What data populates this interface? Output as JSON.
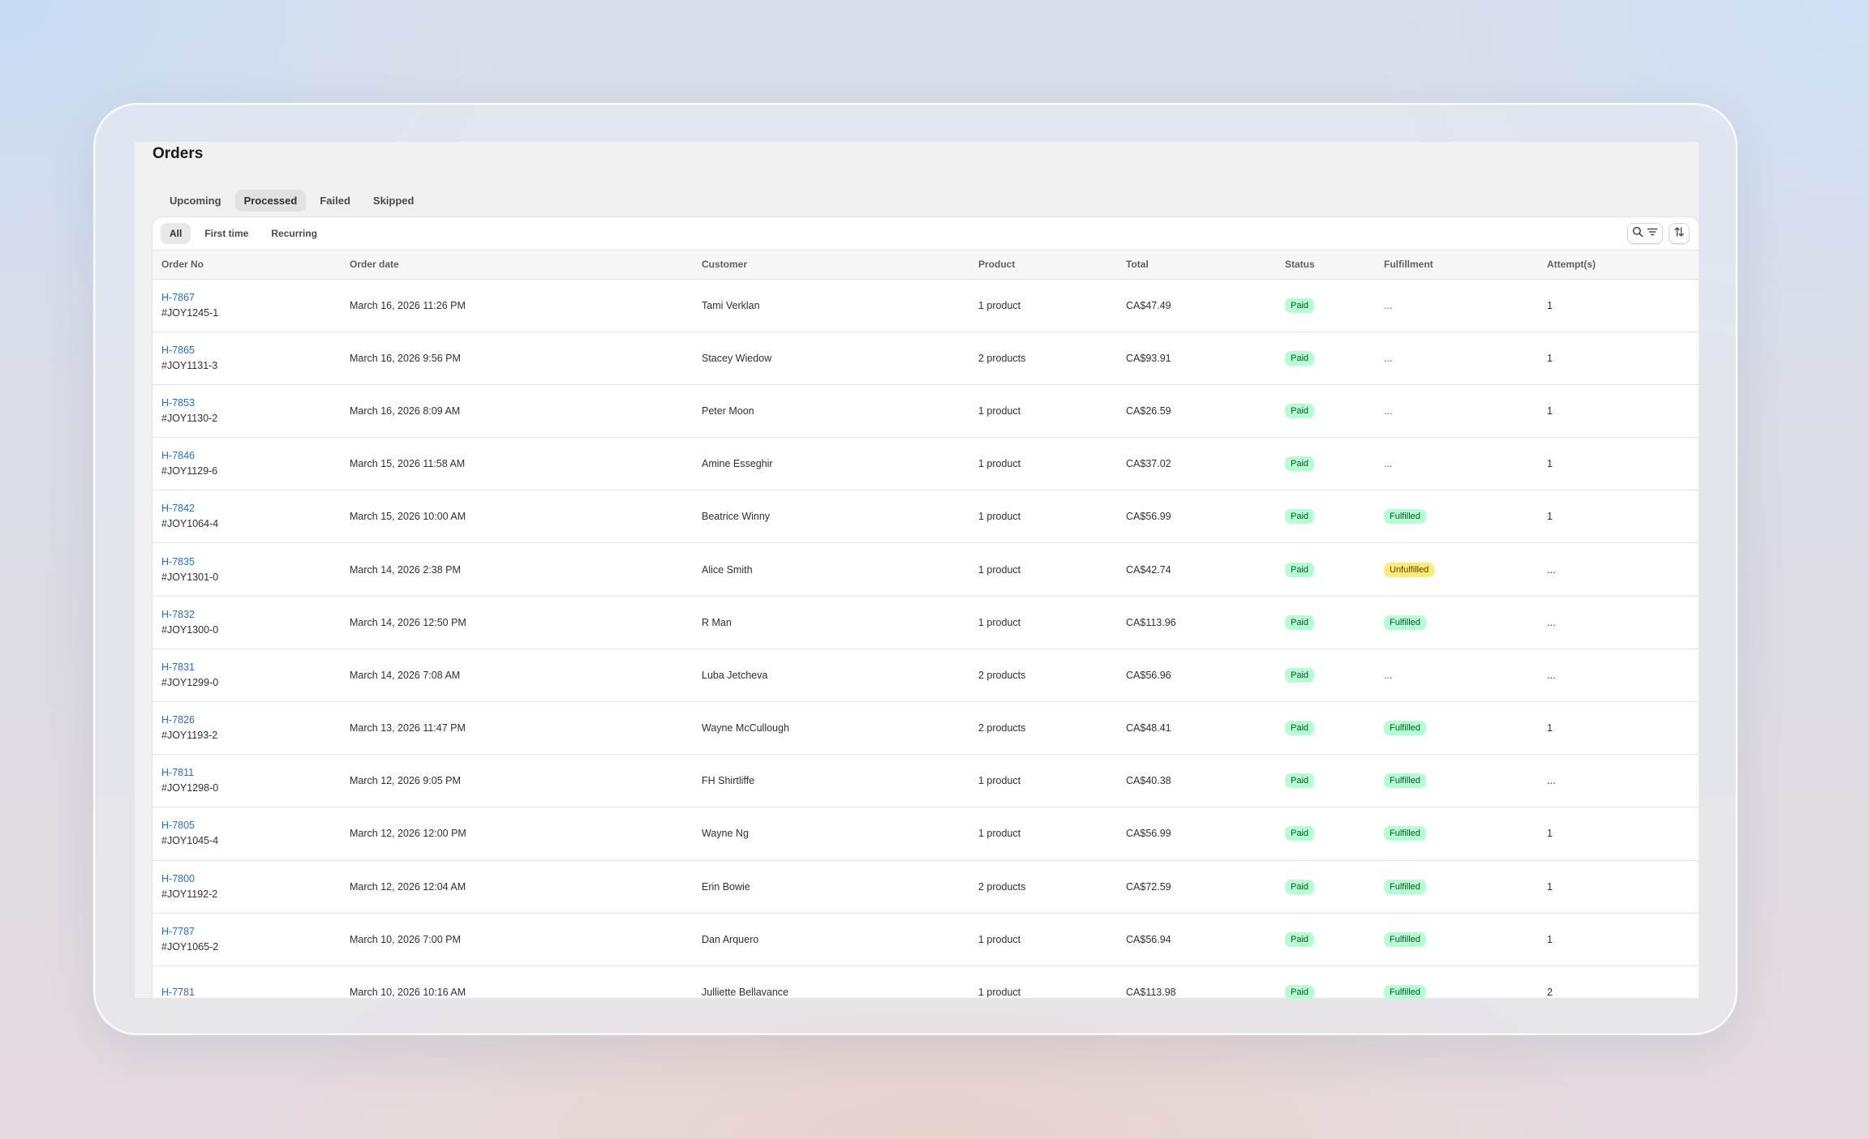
{
  "page": {
    "title": "Orders"
  },
  "tabs": [
    {
      "label": "Upcoming",
      "active": false
    },
    {
      "label": "Processed",
      "active": true
    },
    {
      "label": "Failed",
      "active": false
    },
    {
      "label": "Skipped",
      "active": false
    }
  ],
  "filters": [
    {
      "label": "All",
      "active": true
    },
    {
      "label": "First time",
      "active": false
    },
    {
      "label": "Recurring",
      "active": false
    }
  ],
  "icons": {
    "search": "search-icon",
    "filter": "filter-lines-icon",
    "sort": "sort-arrows-icon"
  },
  "colors": {
    "link": "#2c6ecb",
    "success_badge": "#b4fed2",
    "warning_badge": "#ffeb78"
  },
  "table": {
    "columns": [
      "Order No",
      "Order date",
      "Customer",
      "Product",
      "Total",
      "Status",
      "Fulfillment",
      "Attempt(s)"
    ],
    "rows": [
      {
        "order_no": "H-7867",
        "order_ref": "#JOY1245-1",
        "date": "March 16, 2026 11:26 PM",
        "customer": "Tami Verklan",
        "product": "1 product",
        "total": "CA$47.49",
        "status": "Paid",
        "fulfillment": "...",
        "attempts": "1"
      },
      {
        "order_no": "H-7865",
        "order_ref": "#JOY1131-3",
        "date": "March 16, 2026 9:56 PM",
        "customer": "Stacey Wiedow",
        "product": "2 products",
        "total": "CA$93.91",
        "status": "Paid",
        "fulfillment": "...",
        "attempts": "1"
      },
      {
        "order_no": "H-7853",
        "order_ref": "#JOY1130-2",
        "date": "March 16, 2026 8:09 AM",
        "customer": "Peter Moon",
        "product": "1 product",
        "total": "CA$26.59",
        "status": "Paid",
        "fulfillment": "...",
        "attempts": "1"
      },
      {
        "order_no": "H-7846",
        "order_ref": "#JOY1129-6",
        "date": "March 15, 2026 11:58 AM",
        "customer": "Amine Esseghir",
        "product": "1 product",
        "total": "CA$37.02",
        "status": "Paid",
        "fulfillment": "...",
        "attempts": "1"
      },
      {
        "order_no": "H-7842",
        "order_ref": "#JOY1064-4",
        "date": "March 15, 2026 10:00 AM",
        "customer": "Beatrice Winny",
        "product": "1 product",
        "total": "CA$56.99",
        "status": "Paid",
        "fulfillment": "Fulfilled",
        "attempts": "1"
      },
      {
        "order_no": "H-7835",
        "order_ref": "#JOY1301-0",
        "date": "March 14, 2026 2:38 PM",
        "customer": "Alice Smith",
        "product": "1 product",
        "total": "CA$42.74",
        "status": "Paid",
        "fulfillment": "Unfulfilled",
        "attempts": "..."
      },
      {
        "order_no": "H-7832",
        "order_ref": "#JOY1300-0",
        "date": "March 14, 2026 12:50 PM",
        "customer": "R Man",
        "product": "1 product",
        "total": "CA$113.96",
        "status": "Paid",
        "fulfillment": "Fulfilled",
        "attempts": "..."
      },
      {
        "order_no": "H-7831",
        "order_ref": "#JOY1299-0",
        "date": "March 14, 2026 7:08 AM",
        "customer": "Luba Jetcheva",
        "product": "2 products",
        "total": "CA$56.96",
        "status": "Paid",
        "fulfillment": "...",
        "attempts": "..."
      },
      {
        "order_no": "H-7826",
        "order_ref": "#JOY1193-2",
        "date": "March 13, 2026 11:47 PM",
        "customer": "Wayne McCullough",
        "product": "2 products",
        "total": "CA$48.41",
        "status": "Paid",
        "fulfillment": "Fulfilled",
        "attempts": "1"
      },
      {
        "order_no": "H-7811",
        "order_ref": "#JOY1298-0",
        "date": "March 12, 2026 9:05 PM",
        "customer": "FH Shirtliffe",
        "product": "1 product",
        "total": "CA$40.38",
        "status": "Paid",
        "fulfillment": "Fulfilled",
        "attempts": "..."
      },
      {
        "order_no": "H-7805",
        "order_ref": "#JOY1045-4",
        "date": "March 12, 2026 12:00 PM",
        "customer": "Wayne Ng",
        "product": "1 product",
        "total": "CA$56.99",
        "status": "Paid",
        "fulfillment": "Fulfilled",
        "attempts": "1"
      },
      {
        "order_no": "H-7800",
        "order_ref": "#JOY1192-2",
        "date": "March 12, 2026 12:04 AM",
        "customer": "Erin Bowie",
        "product": "2 products",
        "total": "CA$72.59",
        "status": "Paid",
        "fulfillment": "Fulfilled",
        "attempts": "1"
      },
      {
        "order_no": "H-7787",
        "order_ref": "#JOY1065-2",
        "date": "March 10, 2026 7:00 PM",
        "customer": "Dan Arquero",
        "product": "1 product",
        "total": "CA$56.94",
        "status": "Paid",
        "fulfillment": "Fulfilled",
        "attempts": "1"
      },
      {
        "order_no": "H-7781",
        "order_ref": "",
        "date": "March 10, 2026 10:16 AM",
        "customer": "Julliette Bellavance",
        "product": "1 product",
        "total": "CA$113.98",
        "status": "Paid",
        "fulfillment": "Fulfilled",
        "attempts": "2"
      }
    ]
  }
}
